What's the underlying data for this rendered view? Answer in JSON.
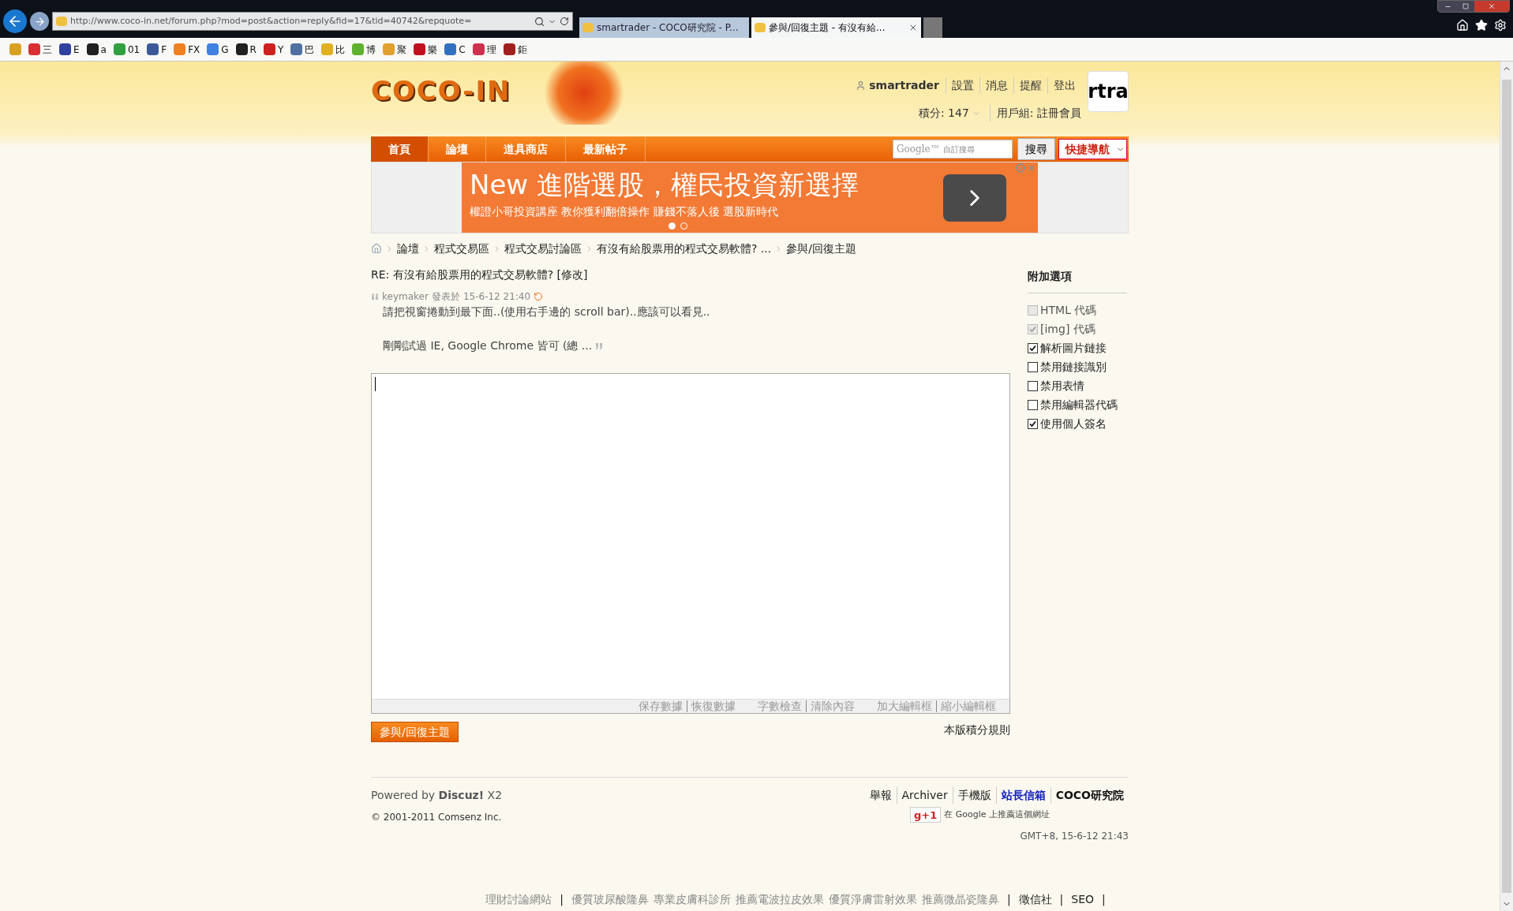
{
  "browser": {
    "address": "http://www.coco-in.net/forum.php?mod=post&action=reply&fid=17&tid=40742&repquote=",
    "tabs": [
      {
        "title": "smartrader - COCO研究院 - P...",
        "selected": false
      },
      {
        "title": "參與/回復主題 - 有沒有給...",
        "selected": true
      }
    ],
    "favorites": [
      {
        "color": "#d8a020"
      },
      {
        "label": "三",
        "color": "#d83030"
      },
      {
        "label": "E",
        "color": "#3040a0"
      },
      {
        "label": "a",
        "color": "#202020"
      },
      {
        "label": "01",
        "color": "#30a040"
      },
      {
        "label": "F",
        "color": "#3b5998"
      },
      {
        "label": "FX",
        "color": "#f08020"
      },
      {
        "label": "G",
        "color": "#4080e0"
      },
      {
        "label": "R",
        "color": "#202020"
      },
      {
        "label": "Y",
        "color": "#cc2020"
      },
      {
        "label": "巴",
        "color": "#5070a0"
      },
      {
        "label": "比",
        "color": "#e0b020"
      },
      {
        "label": "博",
        "color": "#60b030"
      },
      {
        "label": "聚",
        "color": "#e0a030"
      },
      {
        "label": "樂",
        "color": "#c01020"
      },
      {
        "label": "C",
        "color": "#3070c0"
      },
      {
        "label": "理",
        "color": "#d03050"
      },
      {
        "label": "鉅",
        "color": "#a02020"
      }
    ]
  },
  "header": {
    "logo": "COCO-IN",
    "user": "smartrader",
    "user_links": [
      "設置",
      "消息",
      "提醒",
      "登出"
    ],
    "credits": "積分: 147",
    "group": "用戶組: 註冊會員",
    "avatar_text": "rtra"
  },
  "nav": {
    "items": [
      {
        "label": "首頁",
        "selected": true
      },
      {
        "label": "論壇",
        "selected": false
      },
      {
        "label": "道具商店",
        "selected": false
      },
      {
        "label": "最新帖子",
        "selected": false
      }
    ],
    "search_brand": "Google™",
    "search_placeholder": "自訂搜尋",
    "search_button": "搜尋",
    "quick_nav": "快捷導航"
  },
  "ad": {
    "headline": "New 進階選股，權民投資新選擇",
    "subline": "權證小哥投資講座 教你獲利翻倍操作 賺錢不落人後 選股新時代",
    "dots": [
      {
        "selected": true
      },
      {
        "selected": false
      }
    ]
  },
  "breadcrumb": [
    "論壇",
    "程式交易區",
    "程式交易討論區",
    "有沒有給股票用的程式交易軟體? ...",
    "參與/回復主題"
  ],
  "post": {
    "title": "RE: 有沒有給股票用的程式交易軟體? [修改]",
    "author": "keymaker",
    "posted_label": "發表於",
    "time": "15-6-12 21:40",
    "quote_lines": [
      "請把視窗捲動到最下面..(使用右手邊的 scroll bar)..應該可以看見..",
      "剛剛試過 IE, Google Chrome 皆可 (總 ..."
    ],
    "editor_links": [
      [
        "保存數據",
        "恢復數據"
      ],
      [
        "字數檢查",
        "清除內容"
      ],
      [
        "加大編輯框",
        "縮小編輯框"
      ]
    ],
    "submit": "參與/回復主題",
    "rules_link": "本版積分規則"
  },
  "sidebar": {
    "title": "附加選項",
    "options": [
      {
        "label": "HTML 代碼",
        "checked": false,
        "disabled": true
      },
      {
        "label": "[img] 代碼",
        "checked": true,
        "disabled": true
      },
      {
        "label": "解析圖片鏈接",
        "checked": true,
        "disabled": false
      },
      {
        "label": "禁用鏈接識別",
        "checked": false,
        "disabled": false
      },
      {
        "label": "禁用表情",
        "checked": false,
        "disabled": false
      },
      {
        "label": "禁用編輯器代碼",
        "checked": false,
        "disabled": false
      },
      {
        "label": "使用個人簽名",
        "checked": true,
        "disabled": false
      }
    ]
  },
  "footer": {
    "powered": "Powered by **Discuz!** X2",
    "copyright": "© 2001-2011 Comsenz Inc.",
    "links": [
      {
        "label": "舉報",
        "kind": "normal"
      },
      {
        "label": "Archiver",
        "kind": "normal"
      },
      {
        "label": "手機版",
        "kind": "normal"
      },
      {
        "label": "站長信箱",
        "kind": "highlight"
      },
      {
        "label": "COCO研究院",
        "kind": "bold"
      }
    ],
    "gplus": "g+1",
    "gplus_text": "在 Google 上推薦這個網址",
    "time": "GMT+8, 15-6-12 21:43"
  },
  "bottom_links": [
    {
      "label": "理財討論網站",
      "kind": "muted"
    },
    {
      "label": "|",
      "kind": "separator"
    },
    {
      "label": "優質玻尿酸隆鼻",
      "kind": "muted"
    },
    {
      "label": "專業皮膚科診所",
      "kind": "muted"
    },
    {
      "label": "推薦電波拉皮效果",
      "kind": "muted"
    },
    {
      "label": "優質淨膚雷射效果",
      "kind": "muted"
    },
    {
      "label": "推薦微晶瓷隆鼻",
      "kind": "muted"
    },
    {
      "label": "|",
      "kind": "separator"
    },
    {
      "label": "徵信社",
      "kind": "dark"
    },
    {
      "label": "|",
      "kind": "separator"
    },
    {
      "label": "SEO",
      "kind": "dark"
    },
    {
      "label": "|",
      "kind": "separator"
    }
  ]
}
